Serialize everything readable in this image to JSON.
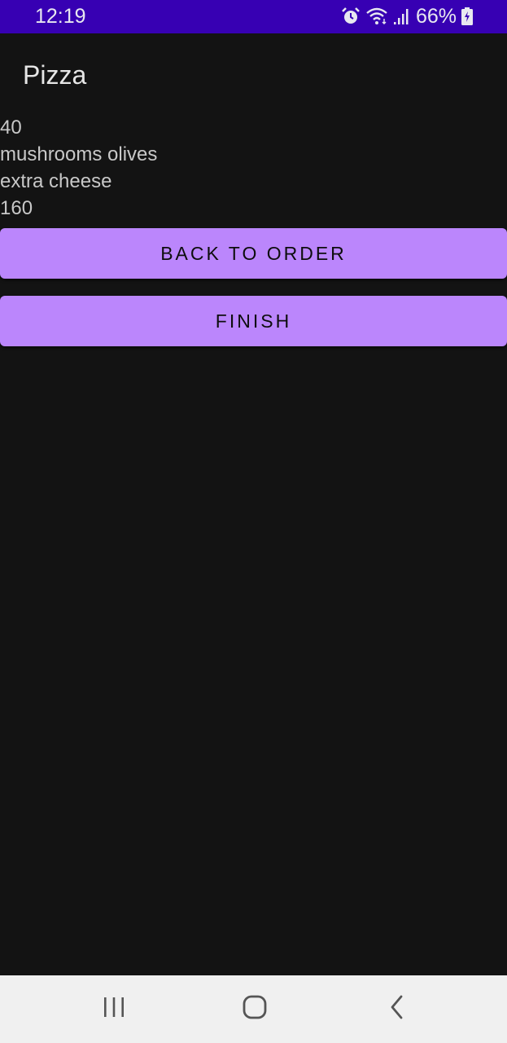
{
  "status_bar": {
    "time": "12:19",
    "battery": "66%",
    "icons": [
      "alarm-icon",
      "wifi-icon",
      "signal-icon",
      "battery-charging-icon"
    ],
    "background_color": "#3700b3"
  },
  "app_bar": {
    "title": "Pizza"
  },
  "order_summary": {
    "lines": [
      "40",
      "mushrooms olives",
      "extra cheese",
      "160"
    ]
  },
  "buttons": {
    "back_to_order": "BACK TO ORDER",
    "finish": "FINISH",
    "color": "#bb86fc"
  },
  "nav_bar": {
    "icons": [
      "recent-apps-icon",
      "home-icon",
      "back-icon"
    ]
  },
  "theme": {
    "background": "#131313",
    "text": "#c8c8c8"
  }
}
